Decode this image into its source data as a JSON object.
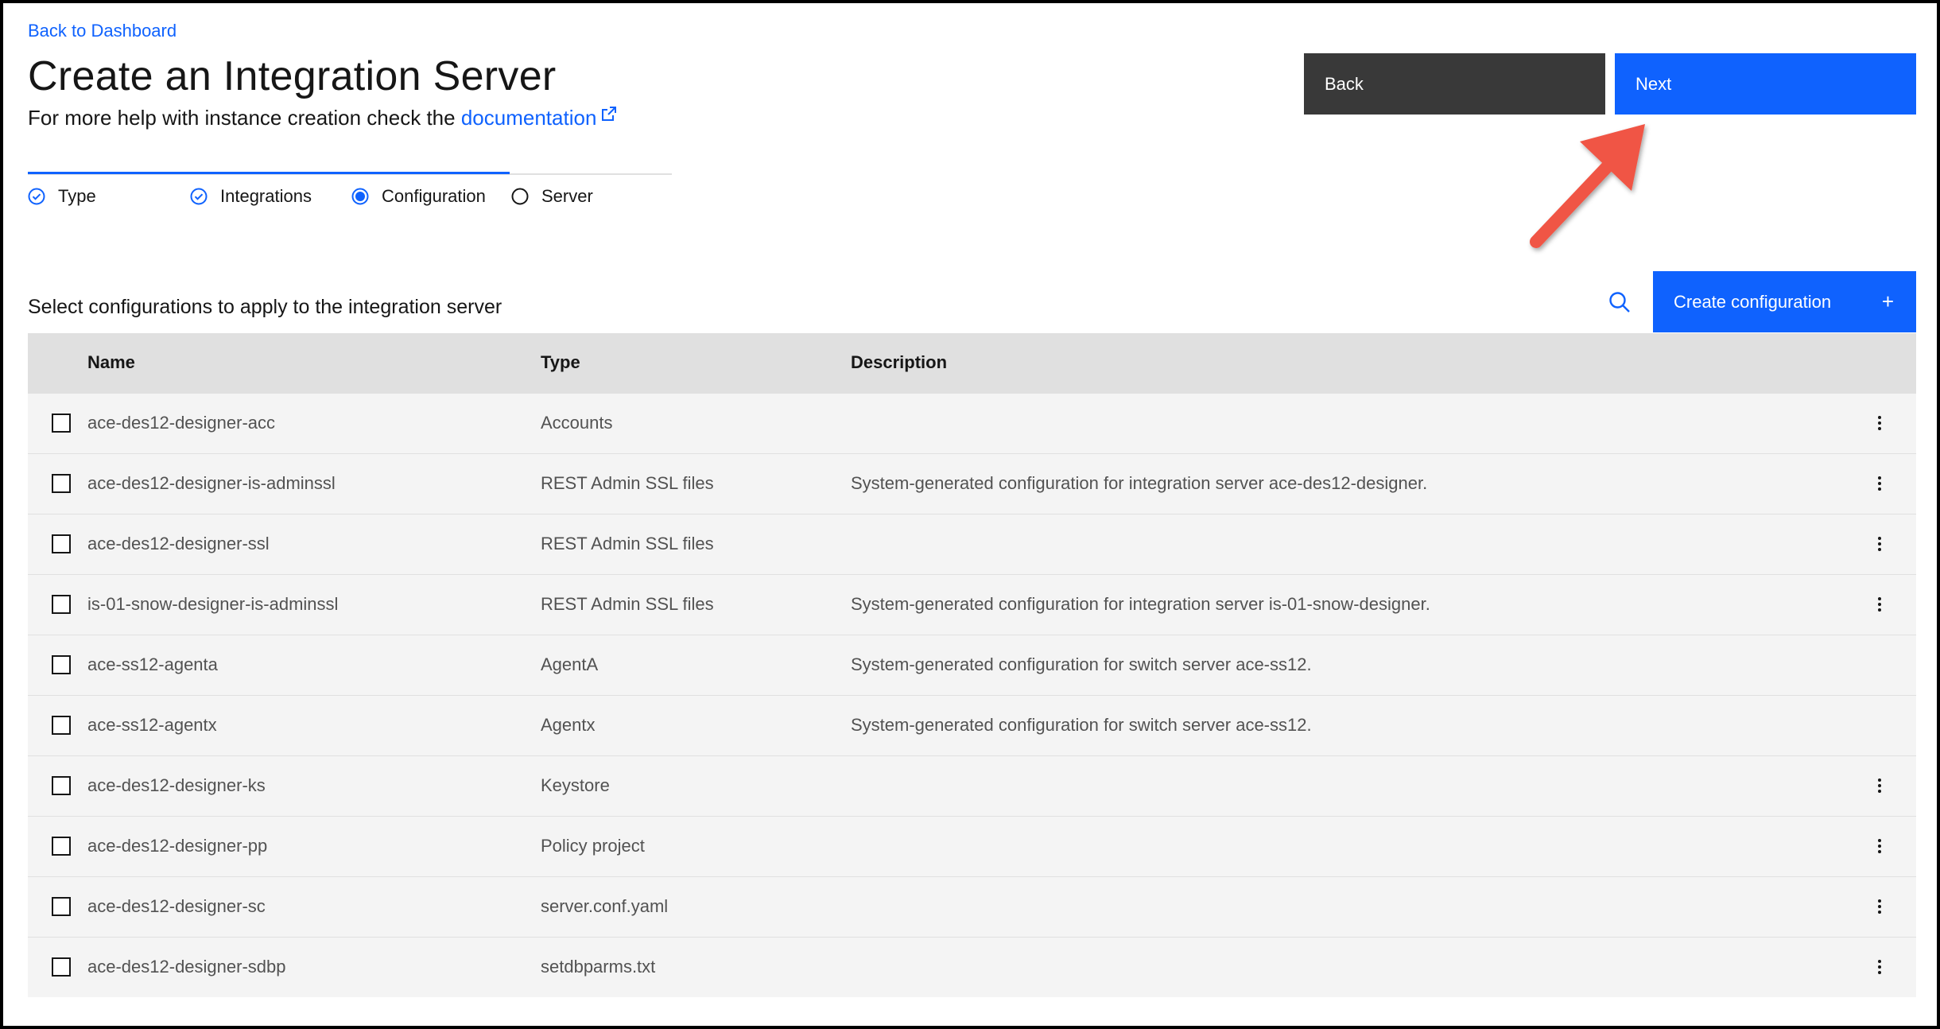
{
  "nav": {
    "back_link": "Back to Dashboard"
  },
  "header": {
    "title": "Create an Integration Server",
    "help_prefix": "For more help with instance creation check the",
    "help_link": "documentation"
  },
  "actions": {
    "back_label": "Back",
    "next_label": "Next"
  },
  "steps": [
    {
      "label": "Type",
      "state": "complete"
    },
    {
      "label": "Integrations",
      "state": "complete"
    },
    {
      "label": "Configuration",
      "state": "current"
    },
    {
      "label": "Server",
      "state": "incomplete"
    }
  ],
  "toolbar": {
    "section_label": "Select configurations to apply to the integration server",
    "create_label": "Create configuration",
    "create_icon": "+"
  },
  "table": {
    "headers": {
      "name": "Name",
      "type": "Type",
      "description": "Description"
    },
    "rows": [
      {
        "name": "ace-des12-designer-acc",
        "type": "Accounts",
        "description": "",
        "menu": true
      },
      {
        "name": "ace-des12-designer-is-adminssl",
        "type": "REST Admin SSL files",
        "description": "System-generated configuration for integration server ace-des12-designer.",
        "menu": true
      },
      {
        "name": "ace-des12-designer-ssl",
        "type": "REST Admin SSL files",
        "description": "",
        "menu": true
      },
      {
        "name": "is-01-snow-designer-is-adminssl",
        "type": "REST Admin SSL files",
        "description": "System-generated configuration for integration server is-01-snow-designer.",
        "menu": true
      },
      {
        "name": "ace-ss12-agenta",
        "type": "AgentA",
        "description": "System-generated configuration for switch server ace-ss12.",
        "menu": false
      },
      {
        "name": "ace-ss12-agentx",
        "type": "Agentx",
        "description": "System-generated configuration for switch server ace-ss12.",
        "menu": false
      },
      {
        "name": "ace-des12-designer-ks",
        "type": "Keystore",
        "description": "",
        "menu": true
      },
      {
        "name": "ace-des12-designer-pp",
        "type": "Policy project",
        "description": "",
        "menu": true
      },
      {
        "name": "ace-des12-designer-sc",
        "type": "server.conf.yaml",
        "description": "",
        "menu": true
      },
      {
        "name": "ace-des12-designer-sdbp",
        "type": "setdbparms.txt",
        "description": "",
        "menu": true
      }
    ]
  },
  "colors": {
    "accent": "#0f62fe",
    "secondary_button": "#393939",
    "annotation_arrow": "#f05545"
  }
}
